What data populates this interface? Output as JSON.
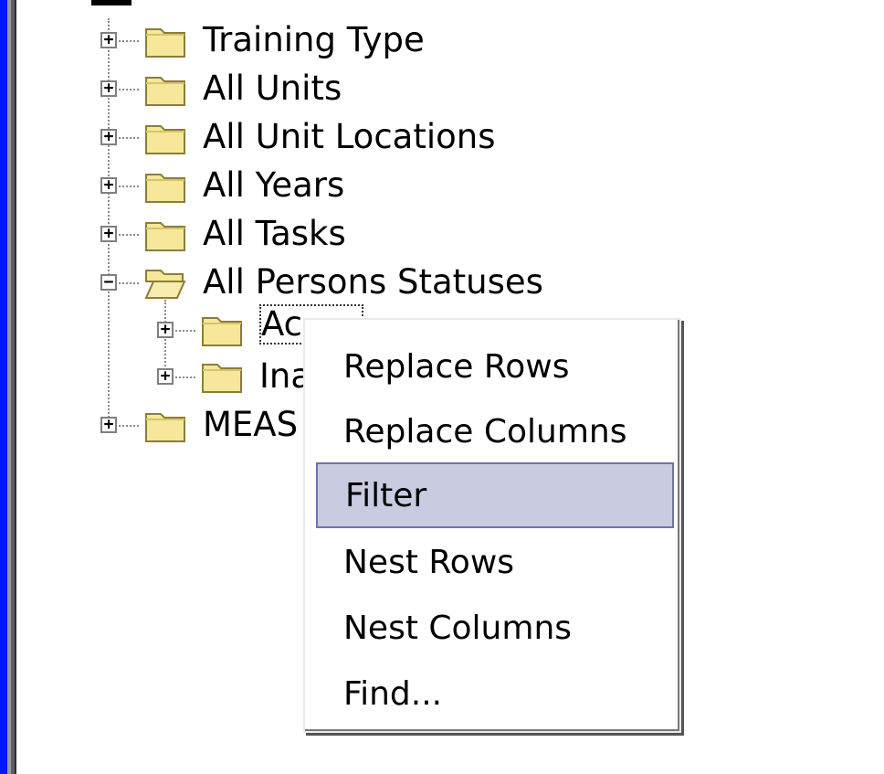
{
  "tree": {
    "items": [
      {
        "label": "Training Type",
        "expander": "+"
      },
      {
        "label": "All Units",
        "expander": "+"
      },
      {
        "label": "All Unit Locations",
        "expander": "+"
      },
      {
        "label": "All Years",
        "expander": "+"
      },
      {
        "label": "All Tasks",
        "expander": "+"
      },
      {
        "label": "All Persons Statuses",
        "expander": "−"
      },
      {
        "label": "Ac",
        "expander": "+"
      },
      {
        "label": "Ina",
        "expander": "+"
      },
      {
        "label": "MEAS",
        "expander": "+"
      }
    ]
  },
  "context_menu": {
    "items": [
      "Replace Rows",
      "Replace Columns",
      "Filter",
      "Nest Rows",
      "Nest Columns",
      "Find..."
    ],
    "highlighted": "Filter"
  },
  "colors": {
    "background": "#0018ff",
    "folder_fill": "#f6e79a",
    "menu_highlight": "#c9cbe0"
  }
}
